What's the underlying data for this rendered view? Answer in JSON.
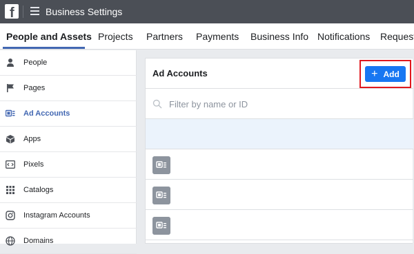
{
  "app": {
    "title": "Business Settings",
    "logo_letter": "f"
  },
  "tabs": [
    {
      "label": "People and Assets",
      "active": true
    },
    {
      "label": "Projects"
    },
    {
      "label": "Partners"
    },
    {
      "label": "Payments"
    },
    {
      "label": "Business Info"
    },
    {
      "label": "Notifications"
    },
    {
      "label": "Requests"
    }
  ],
  "sidebar": {
    "items": [
      {
        "label": "People",
        "icon": "person-icon"
      },
      {
        "label": "Pages",
        "icon": "flag-icon"
      },
      {
        "label": "Ad Accounts",
        "icon": "ad-account-icon",
        "active": true
      },
      {
        "label": "Apps",
        "icon": "cube-icon"
      },
      {
        "label": "Pixels",
        "icon": "code-icon"
      },
      {
        "label": "Catalogs",
        "icon": "grid-icon"
      },
      {
        "label": "Instagram Accounts",
        "icon": "instagram-icon"
      },
      {
        "label": "Domains",
        "icon": "globe-icon"
      }
    ]
  },
  "panel": {
    "title": "Ad Accounts",
    "add_label": "Add",
    "filter_placeholder": "Filter by name or ID"
  },
  "colors": {
    "topbar": "#4b4f56",
    "accent": "#4267b2",
    "button": "#1877f2",
    "highlight": "#e0181e",
    "selected_row": "#ebf3fc"
  }
}
